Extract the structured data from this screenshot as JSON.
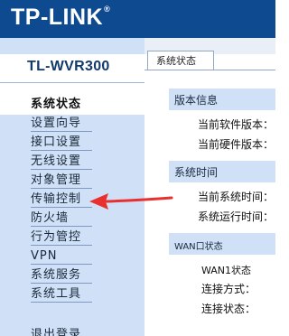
{
  "header": {
    "logo_text": "TP-LINK",
    "logo_mark": "®"
  },
  "sidebar": {
    "model": "TL-WVR300",
    "items": [
      {
        "label": "系统状态",
        "active": true
      },
      {
        "label": "设置向导"
      },
      {
        "label": "接口设置"
      },
      {
        "label": "无线设置"
      },
      {
        "label": "对象管理"
      },
      {
        "label": "传输控制"
      },
      {
        "label": "防火墙"
      },
      {
        "label": "行为管控"
      },
      {
        "label": "VPN"
      },
      {
        "label": "系统服务"
      },
      {
        "label": "系统工具"
      },
      {
        "label": "退出登录"
      }
    ]
  },
  "tab": {
    "label": "系统状态"
  },
  "content": {
    "version": {
      "title": "版本信息",
      "software_label": "当前软件版本：",
      "hardware_label": "当前硬件版本："
    },
    "time": {
      "title": "系统时间",
      "current_label": "当前系统时间：",
      "uptime_label": "系统运行时间："
    },
    "wan": {
      "title": "WAN口状态",
      "wan1_label": "WAN1状态",
      "conn_type_label": "连接方式：",
      "conn_status_label": "连接状态："
    }
  },
  "colors": {
    "header": "#0d4a8f",
    "sidebar": "#cfe0f7",
    "arrow": "#e8312e"
  }
}
